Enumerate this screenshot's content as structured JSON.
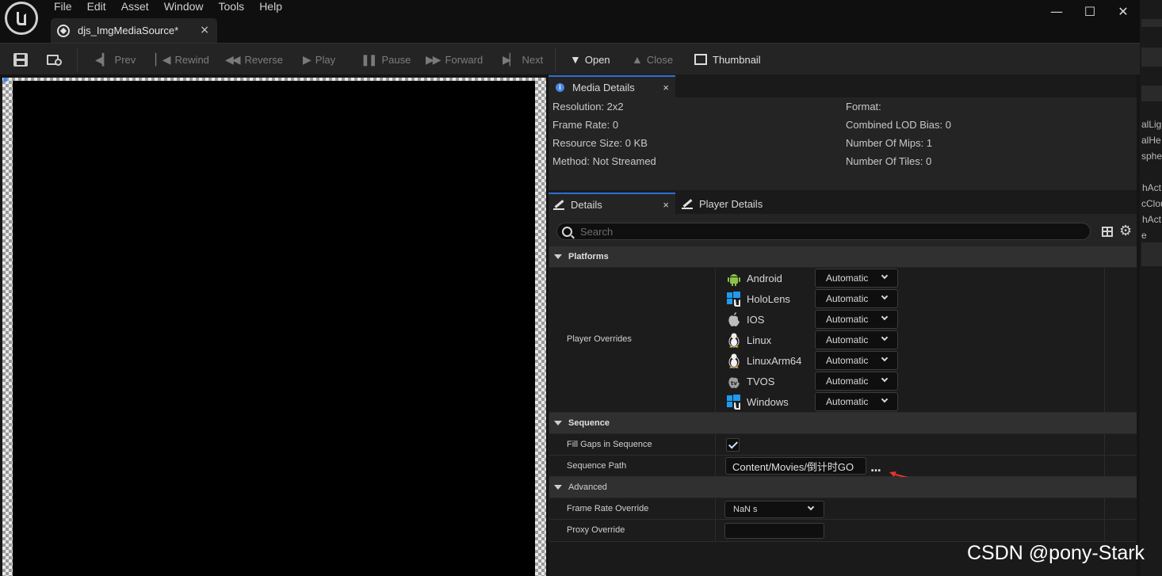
{
  "menu": [
    "File",
    "Edit",
    "Asset",
    "Window",
    "Tools",
    "Help"
  ],
  "document_tab": {
    "title": "djs_ImgMediaSource*",
    "close": "×"
  },
  "window_controls": {
    "minimize": "—",
    "maximize": "☐",
    "close": "✕"
  },
  "toolbar": {
    "prev": "Prev",
    "rewind": "Rewind",
    "reverse": "Reverse",
    "play": "Play",
    "pause": "Pause",
    "forward": "Forward",
    "next": "Next",
    "open": "Open",
    "close": "Close",
    "thumbnail": "Thumbnail"
  },
  "media_details": {
    "tab": "Media Details",
    "close": "×",
    "left": [
      "Resolution: 2x2",
      "Frame Rate: 0",
      "Resource Size: 0 KB",
      "Method: Not Streamed"
    ],
    "right": [
      "Format:",
      "Combined LOD Bias: 0",
      "Number Of Mips: 1",
      "Number Of Tiles: 0"
    ]
  },
  "details": {
    "tab": "Details",
    "close": "×",
    "player_tab": "Player Details",
    "search_placeholder": "Search"
  },
  "platforms": {
    "category": "Platforms",
    "label": "Player Overrides",
    "items": [
      {
        "name": "Android",
        "value": "Automatic",
        "icon": "android-icon"
      },
      {
        "name": "HoloLens",
        "value": "Automatic",
        "icon": "windows-unreal-icon"
      },
      {
        "name": "IOS",
        "value": "Automatic",
        "icon": "apple-icon"
      },
      {
        "name": "Linux",
        "value": "Automatic",
        "icon": "linux-icon"
      },
      {
        "name": "LinuxArm64",
        "value": "Automatic",
        "icon": "linux-icon"
      },
      {
        "name": "TVOS",
        "value": "Automatic",
        "icon": "apple-tv-icon"
      },
      {
        "name": "Windows",
        "value": "Automatic",
        "icon": "windows-unreal-icon"
      }
    ]
  },
  "sequence": {
    "category": "Sequence",
    "fill_gaps_label": "Fill Gaps in Sequence",
    "fill_gaps_checked": true,
    "path_label": "Sequence Path",
    "path_value": "Content/Movies/倒计时GO",
    "browse": "..."
  },
  "advanced": {
    "category": "Advanced",
    "frame_rate_label": "Frame Rate Override",
    "frame_rate_value": "NaN s",
    "proxy_label": "Proxy Override",
    "proxy_value": ""
  },
  "background_strip": [
    "alLigh",
    "alHe",
    "spher",
    "hAct",
    "cClou",
    "hAct",
    "e"
  ],
  "watermark": "CSDN @pony-Stark",
  "colors": {
    "accent": "#2f6fd6",
    "arrow": "#e8342a",
    "android": "#8bc34a",
    "windows": "#1e9bf0"
  }
}
